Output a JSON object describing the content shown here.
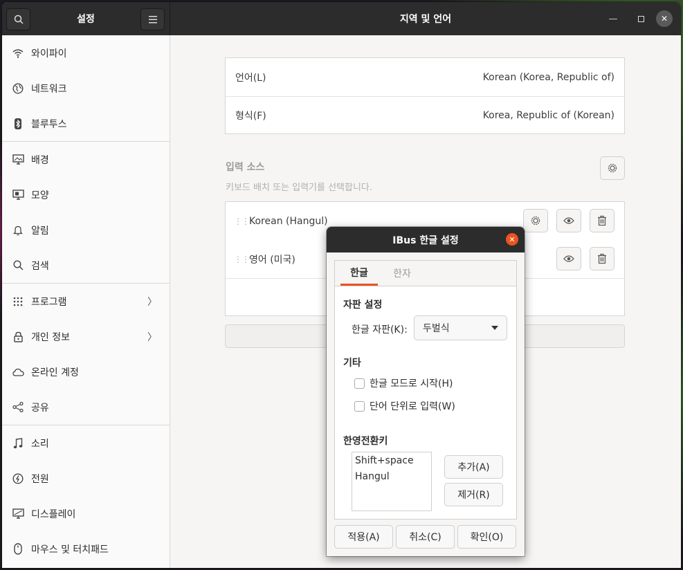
{
  "header": {
    "sidebar_title": "설정",
    "panel_title": "지역 및 언어"
  },
  "sidebar": {
    "items": [
      {
        "label": "와이파이",
        "icon": "wifi-icon"
      },
      {
        "label": "네트워크",
        "icon": "network-icon"
      },
      {
        "label": "블루투스",
        "icon": "bluetooth-icon"
      },
      {
        "label": "배경",
        "icon": "background-icon"
      },
      {
        "label": "모양",
        "icon": "appearance-icon"
      },
      {
        "label": "알림",
        "icon": "bell-icon"
      },
      {
        "label": "검색",
        "icon": "search-icon"
      },
      {
        "label": "프로그램",
        "icon": "apps-grid-icon",
        "chevron": true
      },
      {
        "label": "개인 정보",
        "icon": "lock-icon",
        "chevron": true
      },
      {
        "label": "온라인 계정",
        "icon": "cloud-icon"
      },
      {
        "label": "공유",
        "icon": "share-icon"
      },
      {
        "label": "소리",
        "icon": "music-note-icon"
      },
      {
        "label": "전원",
        "icon": "power-icon"
      },
      {
        "label": "디스플레이",
        "icon": "display-icon"
      },
      {
        "label": "마우스 및 터치패드",
        "icon": "mouse-icon"
      }
    ]
  },
  "region": {
    "language_label": "언어(L)",
    "language_value": "Korean (Korea, Republic of)",
    "formats_label": "형식(F)",
    "formats_value": "Korea, Republic of (Korean)"
  },
  "input_sources": {
    "title": "입력 소스",
    "subtitle": "키보드 배치 또는 입력기를 선택합니다.",
    "items": [
      {
        "name": "Korean (Hangul)"
      },
      {
        "name": "영어 (미국)"
      }
    ]
  },
  "dialog": {
    "title": "IBus 한글 설정",
    "tabs": [
      "한글",
      "한자"
    ],
    "layout_section": "자판 설정",
    "layout_label": "한글 자판(K):",
    "layout_value": "두벌식",
    "etc_section": "기타",
    "checkbox_start_hangul": "한글 모드로 시작(H)",
    "checkbox_word_commit": "단어 단위로 입력(W)",
    "hotkey_section": "한영전환키",
    "hotkeys": [
      "Shift+space",
      "Hangul"
    ],
    "add_label": "추가(A)",
    "remove_label": "제거(R)",
    "apply_label": "적용(A)",
    "cancel_label": "취소(C)",
    "ok_label": "확인(O)"
  },
  "colors": {
    "accent": "#e9541f",
    "headerbar": "#2c2c2c"
  }
}
